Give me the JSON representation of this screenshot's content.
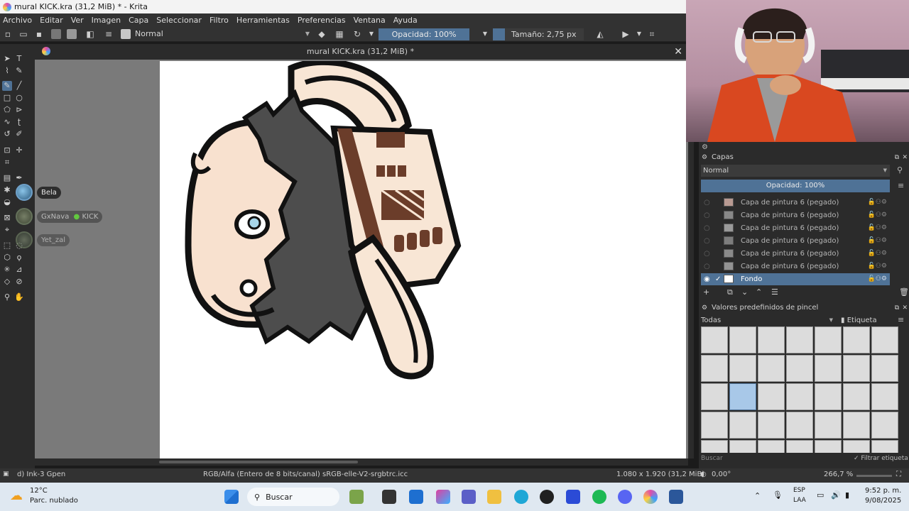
{
  "window": {
    "title": "mural KICK.kra (31,2 MiB) * - Krita"
  },
  "menu": [
    "Archivo",
    "Editar",
    "Ver",
    "Imagen",
    "Capa",
    "Seleccionar",
    "Filtro",
    "Herramientas",
    "Preferencias",
    "Ventana",
    "Ayuda"
  ],
  "tool_options": {
    "blend_mode": "Normal",
    "opacity_label": "Opacidad: 100%",
    "size_label": "Tamaño: 2,75 px"
  },
  "document": {
    "tab_title": "mural KICK.kra (31,2 MiB) *",
    "close_icon": "✕"
  },
  "chat": [
    {
      "name": "Bela"
    },
    {
      "name": "GxNava",
      "badge": "KICK"
    },
    {
      "name": "Yet_zal"
    }
  ],
  "layers_docker": {
    "title": "Capas",
    "blend_mode": "Normal",
    "opacity_label": "Opacidad:  100%",
    "layers": [
      {
        "name": "Capa de pintura 6 (pegado)",
        "active": false
      },
      {
        "name": "Capa de pintura 6 (pegado)",
        "active": false
      },
      {
        "name": "Capa de pintura 6 (pegado)",
        "active": false
      },
      {
        "name": "Capa de pintura 6 (pegado)",
        "active": false
      },
      {
        "name": "Capa de pintura 6 (pegado)",
        "active": false
      },
      {
        "name": "Capa de pintura 6 (pegado)",
        "active": false
      },
      {
        "name": "Fondo",
        "active": true
      }
    ]
  },
  "brush_docker": {
    "title": "Valores predefinidos de pincel",
    "filter_select": "Todas",
    "tag_label": "Etiqueta",
    "search_placeholder": "Buscar",
    "filter_tag_label": "Filtrar etiqueta"
  },
  "status": {
    "brush_name": "d) Ink-3 Gpen",
    "color_profile": "RGB/Alfa (Entero de 8 bits/canal)  sRGB-elle-V2-srgbtrc.icc",
    "dimensions": "1.080 x 1.920 (31,2 MiB)",
    "rotation": "0,00°",
    "zoom": "266,7 %"
  },
  "taskbar": {
    "weather_temp": "12°C",
    "weather_desc": "Parc. nublado",
    "search_label": "Buscar",
    "lang_top": "ESP",
    "lang_bottom": "LAA",
    "time": "9:52 p. m.",
    "date": "9/08/2025"
  },
  "colors": {
    "accent": "#4f7296",
    "panel": "#2b2b2b",
    "menubar": "#323232",
    "taskbar": "#dfe8f1"
  }
}
